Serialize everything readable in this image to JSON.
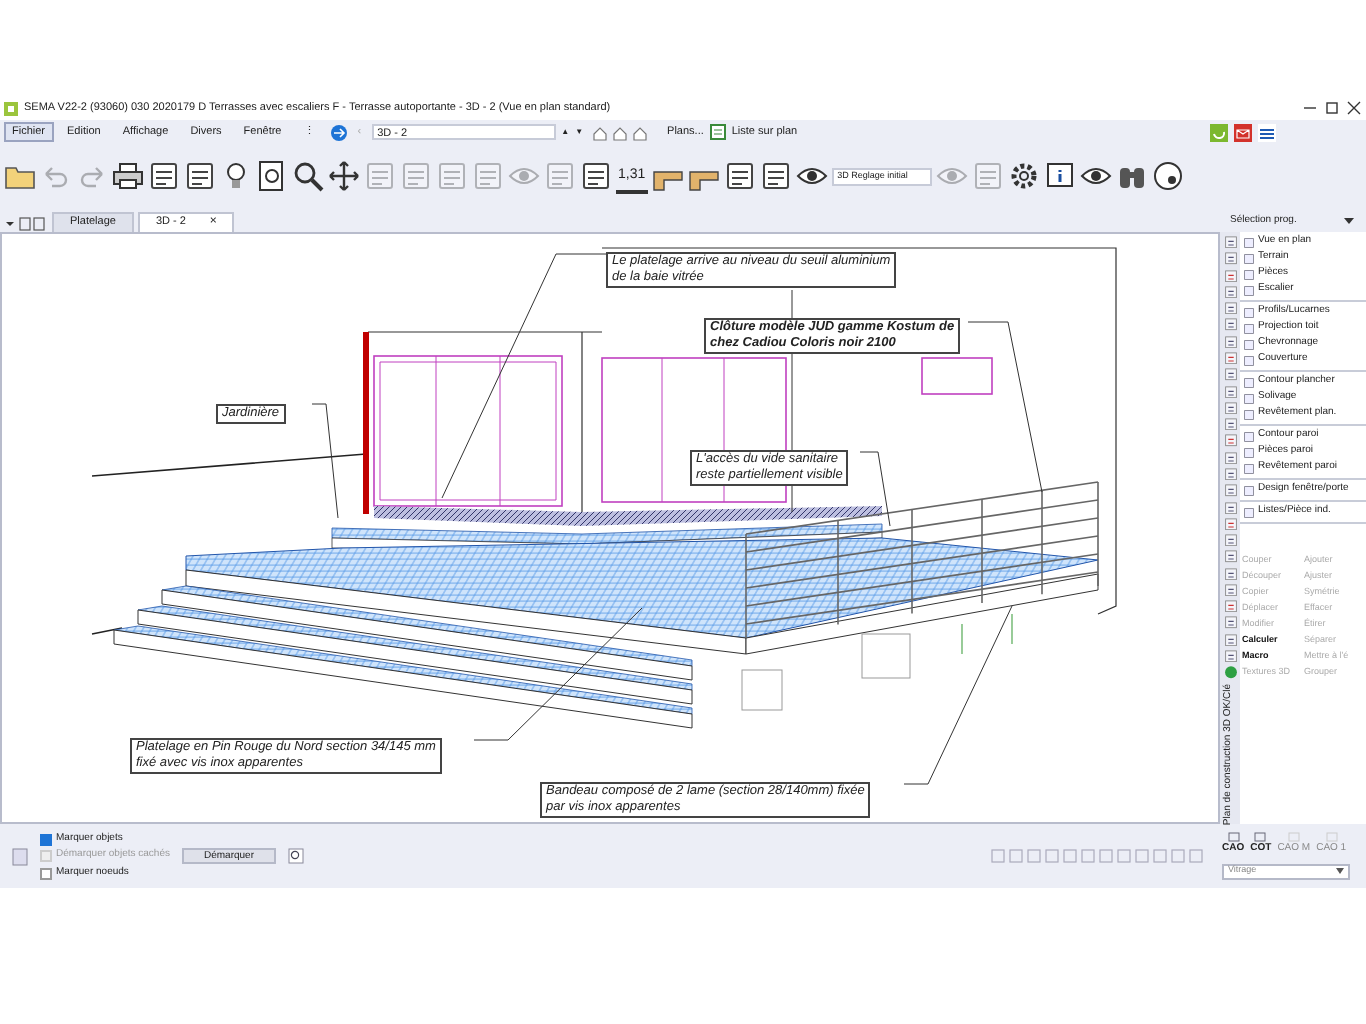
{
  "window": {
    "title": "SEMA V22-2 (93060) 030 2020179 D Terrasses avec escaliers F - Terrasse autoportante - 3D - 2 (Vue en plan standard)"
  },
  "menu": [
    {
      "label": "Fichier",
      "selected": true
    },
    {
      "label": "Edition",
      "selected": false
    },
    {
      "label": "Affichage",
      "selected": false
    },
    {
      "label": "Divers",
      "selected": false
    },
    {
      "label": "Fenêtre",
      "selected": false
    },
    {
      "label": "⋮",
      "selected": false
    }
  ],
  "quickbar": {
    "back": "‹",
    "view_field": "3D - 2",
    "up": "▲",
    "down": "▼",
    "plans": "Plans...",
    "list": "Liste sur plan"
  },
  "toolbar": [
    {
      "kind": "folder",
      "disabled": false
    },
    {
      "kind": "undo",
      "disabled": true
    },
    {
      "kind": "redo",
      "disabled": true
    },
    {
      "kind": "printer",
      "disabled": false
    },
    {
      "kind": "tool",
      "disabled": false
    },
    {
      "kind": "tool",
      "disabled": false
    },
    {
      "kind": "bulb",
      "disabled": false
    },
    {
      "kind": "page",
      "disabled": false
    },
    {
      "kind": "search",
      "disabled": false
    },
    {
      "kind": "move",
      "disabled": false
    },
    {
      "kind": "tool",
      "disabled": true
    },
    {
      "kind": "tool",
      "disabled": true
    },
    {
      "kind": "tool",
      "disabled": true
    },
    {
      "kind": "tool",
      "disabled": true
    },
    {
      "kind": "eye",
      "disabled": true
    },
    {
      "kind": "tool",
      "disabled": true
    },
    {
      "kind": "tool",
      "disabled": false
    },
    {
      "kind": "dimension",
      "disabled": false,
      "label": "1,31"
    },
    {
      "kind": "beam",
      "disabled": false
    },
    {
      "kind": "beam",
      "disabled": false
    },
    {
      "kind": "tool",
      "disabled": false
    },
    {
      "kind": "tool",
      "disabled": false
    },
    {
      "kind": "eye",
      "disabled": false
    },
    {
      "kind": "dropdown",
      "disabled": false,
      "label": "3D Reglage initial"
    },
    {
      "kind": "eye",
      "disabled": true
    },
    {
      "kind": "tool",
      "disabled": true
    },
    {
      "kind": "gear",
      "disabled": false
    },
    {
      "kind": "info",
      "disabled": false
    },
    {
      "kind": "eye",
      "disabled": false
    },
    {
      "kind": "binoculars",
      "disabled": false
    },
    {
      "kind": "disc",
      "disabled": false
    }
  ],
  "tabs": [
    {
      "label": "Platelage",
      "selected": false
    },
    {
      "label": "3D - 2",
      "selected": true,
      "close": "×"
    }
  ],
  "panel_selector": "Sélection prog.",
  "callouts": [
    {
      "lines": [
        "Le platelage arrive au niveau du seuil aluminium",
        "de la baie vitrée"
      ]
    },
    {
      "lines": [
        "Clôture modèle JUD gamme Kostum de",
        "chez Cadiou Coloris noir 2100"
      ]
    },
    {
      "lines": [
        "Jardinière"
      ]
    },
    {
      "lines": [
        "L'accès du vide sanitaire",
        "reste partiellement visible"
      ]
    },
    {
      "lines": [
        "Platelage en Pin Rouge du Nord section 34/145 mm",
        "fixé avec vis inox apparentes"
      ]
    },
    {
      "lines": [
        "Bandeau composé de 2 lame (section 28/140mm) fixée",
        "par vis inox apparentes"
      ]
    }
  ],
  "module_groups": [
    {
      "items": [
        "Vue en plan",
        "Terrain",
        "Pièces",
        "Escalier"
      ]
    },
    {
      "items": [
        "Profils/Lucarnes",
        "Projection toit",
        "Chevronnage",
        "Couverture"
      ]
    },
    {
      "items": [
        "Contour plancher",
        "Solivage",
        "Revêtement plan."
      ]
    },
    {
      "items": [
        "Contour paroi",
        "Pièces paroi",
        "Revêtement paroi"
      ]
    },
    {
      "items": [
        "Design fenêtre/porte"
      ]
    },
    {
      "items": [
        "Listes/Pièce ind."
      ]
    }
  ],
  "edit_tools": [
    {
      "label": "Couper",
      "disabled": true
    },
    {
      "label": "Ajouter",
      "disabled": true
    },
    {
      "label": "Découper",
      "disabled": true
    },
    {
      "label": "Ajuster",
      "disabled": true
    },
    {
      "label": "Copier",
      "disabled": true
    },
    {
      "label": "Symétrie",
      "disabled": true
    },
    {
      "label": "Déplacer",
      "disabled": true
    },
    {
      "label": "Effacer",
      "disabled": true
    },
    {
      "label": "Modifier",
      "disabled": true
    },
    {
      "label": "Étirer",
      "disabled": true
    },
    {
      "label": "Calculer",
      "disabled": false
    },
    {
      "label": "Séparer",
      "disabled": true
    },
    {
      "label": "Macro",
      "disabled": false
    },
    {
      "label": "Mettre à l'é",
      "disabled": true
    },
    {
      "label": "Textures 3D",
      "disabled": true
    },
    {
      "label": "Grouper",
      "disabled": true
    }
  ],
  "status_vertical": "Plan de construction 3D OK/Clé",
  "bottom": {
    "options": [
      {
        "label": "Marquer objets",
        "checked": true,
        "disabled": false
      },
      {
        "label": "Démarquer objets cachés",
        "checked": false,
        "disabled": true
      },
      {
        "label": "Marquer noeuds",
        "checked": false,
        "disabled": false
      }
    ],
    "unmark_button": "Démarquer",
    "modes": [
      {
        "label": "CAO",
        "disabled": false
      },
      {
        "label": "COT",
        "disabled": false
      },
      {
        "label": "CAO M",
        "disabled": true
      },
      {
        "label": "CAO 1",
        "disabled": true
      }
    ],
    "material": "Vitrage"
  }
}
